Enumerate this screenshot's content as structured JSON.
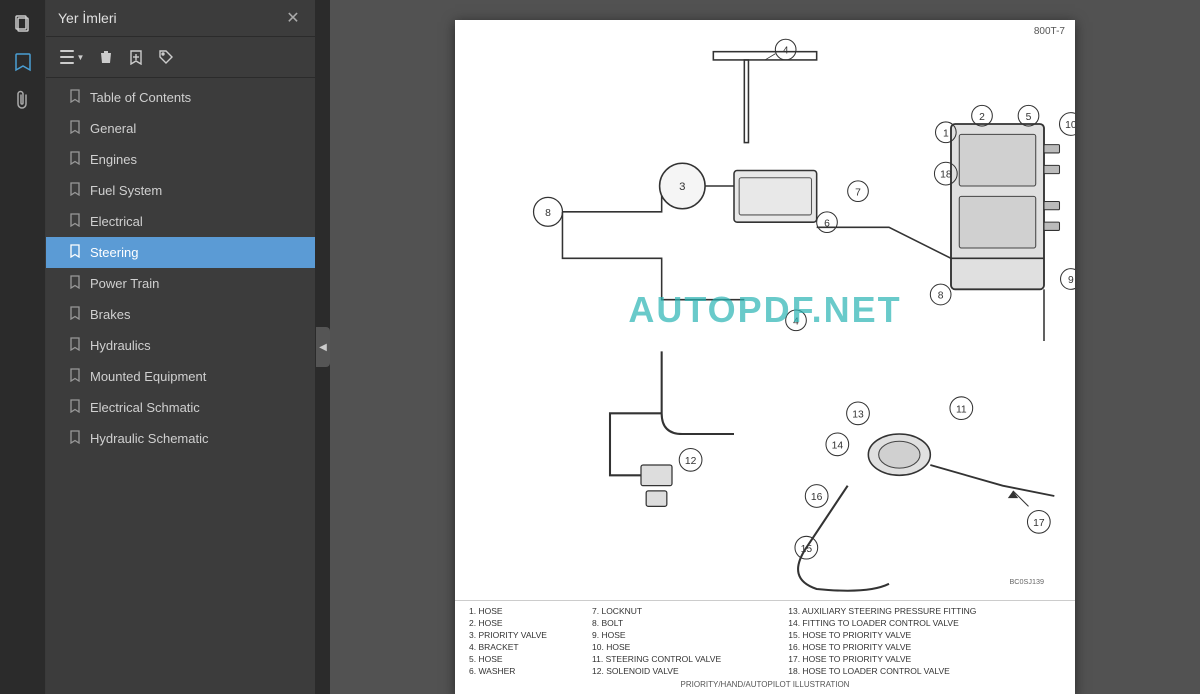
{
  "app": {
    "title": "Yer İmleri",
    "page_number": "800T-7"
  },
  "toolbar": {
    "icons": [
      "pages",
      "bookmarks",
      "attachments"
    ]
  },
  "sidebar": {
    "title": "Yer İmleri",
    "actions": [
      {
        "id": "menu",
        "label": "☰",
        "has_arrow": true
      },
      {
        "id": "delete",
        "label": "🗑"
      },
      {
        "id": "add-bookmark",
        "label": "🔖+"
      },
      {
        "id": "tag",
        "label": "🏷"
      }
    ],
    "items": [
      {
        "id": "table-of-contents",
        "label": "Table of Contents",
        "active": false
      },
      {
        "id": "general",
        "label": "General",
        "active": false
      },
      {
        "id": "engines",
        "label": "Engines",
        "active": false
      },
      {
        "id": "fuel-system",
        "label": "Fuel System",
        "active": false
      },
      {
        "id": "electrical",
        "label": "Electrical",
        "active": false
      },
      {
        "id": "steering",
        "label": "Steering",
        "active": true
      },
      {
        "id": "power-train",
        "label": "Power Train",
        "active": false
      },
      {
        "id": "brakes",
        "label": "Brakes",
        "active": false
      },
      {
        "id": "hydraulics",
        "label": "Hydraulics",
        "active": false
      },
      {
        "id": "mounted-equipment",
        "label": "Mounted Equipment",
        "active": false
      },
      {
        "id": "electrical-schmatic",
        "label": "Electrical Schmatic",
        "active": false
      },
      {
        "id": "hydraulic-schematic",
        "label": "Hydraulic Schematic",
        "active": false
      }
    ]
  },
  "document": {
    "page_number": "800T-7",
    "watermark": "AUTOPDF.NET",
    "legend": {
      "columns": [
        [
          "1. HOSE",
          "2. HOSE",
          "3. PRIORITY VALVE",
          "4. BRACKET",
          "5. HOSE",
          "6. WASHER"
        ],
        [
          "7. LOCKNUT",
          "8. BOLT",
          "9. HOSE",
          "10. HOSE",
          "11. STEERING CONTROL VALVE",
          "12. SOLENOID VALVE"
        ],
        [
          "13. AUXILIARY STEERING PRESSURE FITTING",
          "14. FITTING TO LOADER CONTROL VALVE",
          "15. HOSE TO PRIORITY VALVE",
          "16. HOSE TO PRIORITY VALVE",
          "17. HOSE TO PRIORITY VALVE",
          "18. HOSE TO LOADER CONTROL VALVE"
        ]
      ],
      "caption": "PRIORITY/HAND/AUTOPILOT ILLUSTRATION"
    }
  }
}
